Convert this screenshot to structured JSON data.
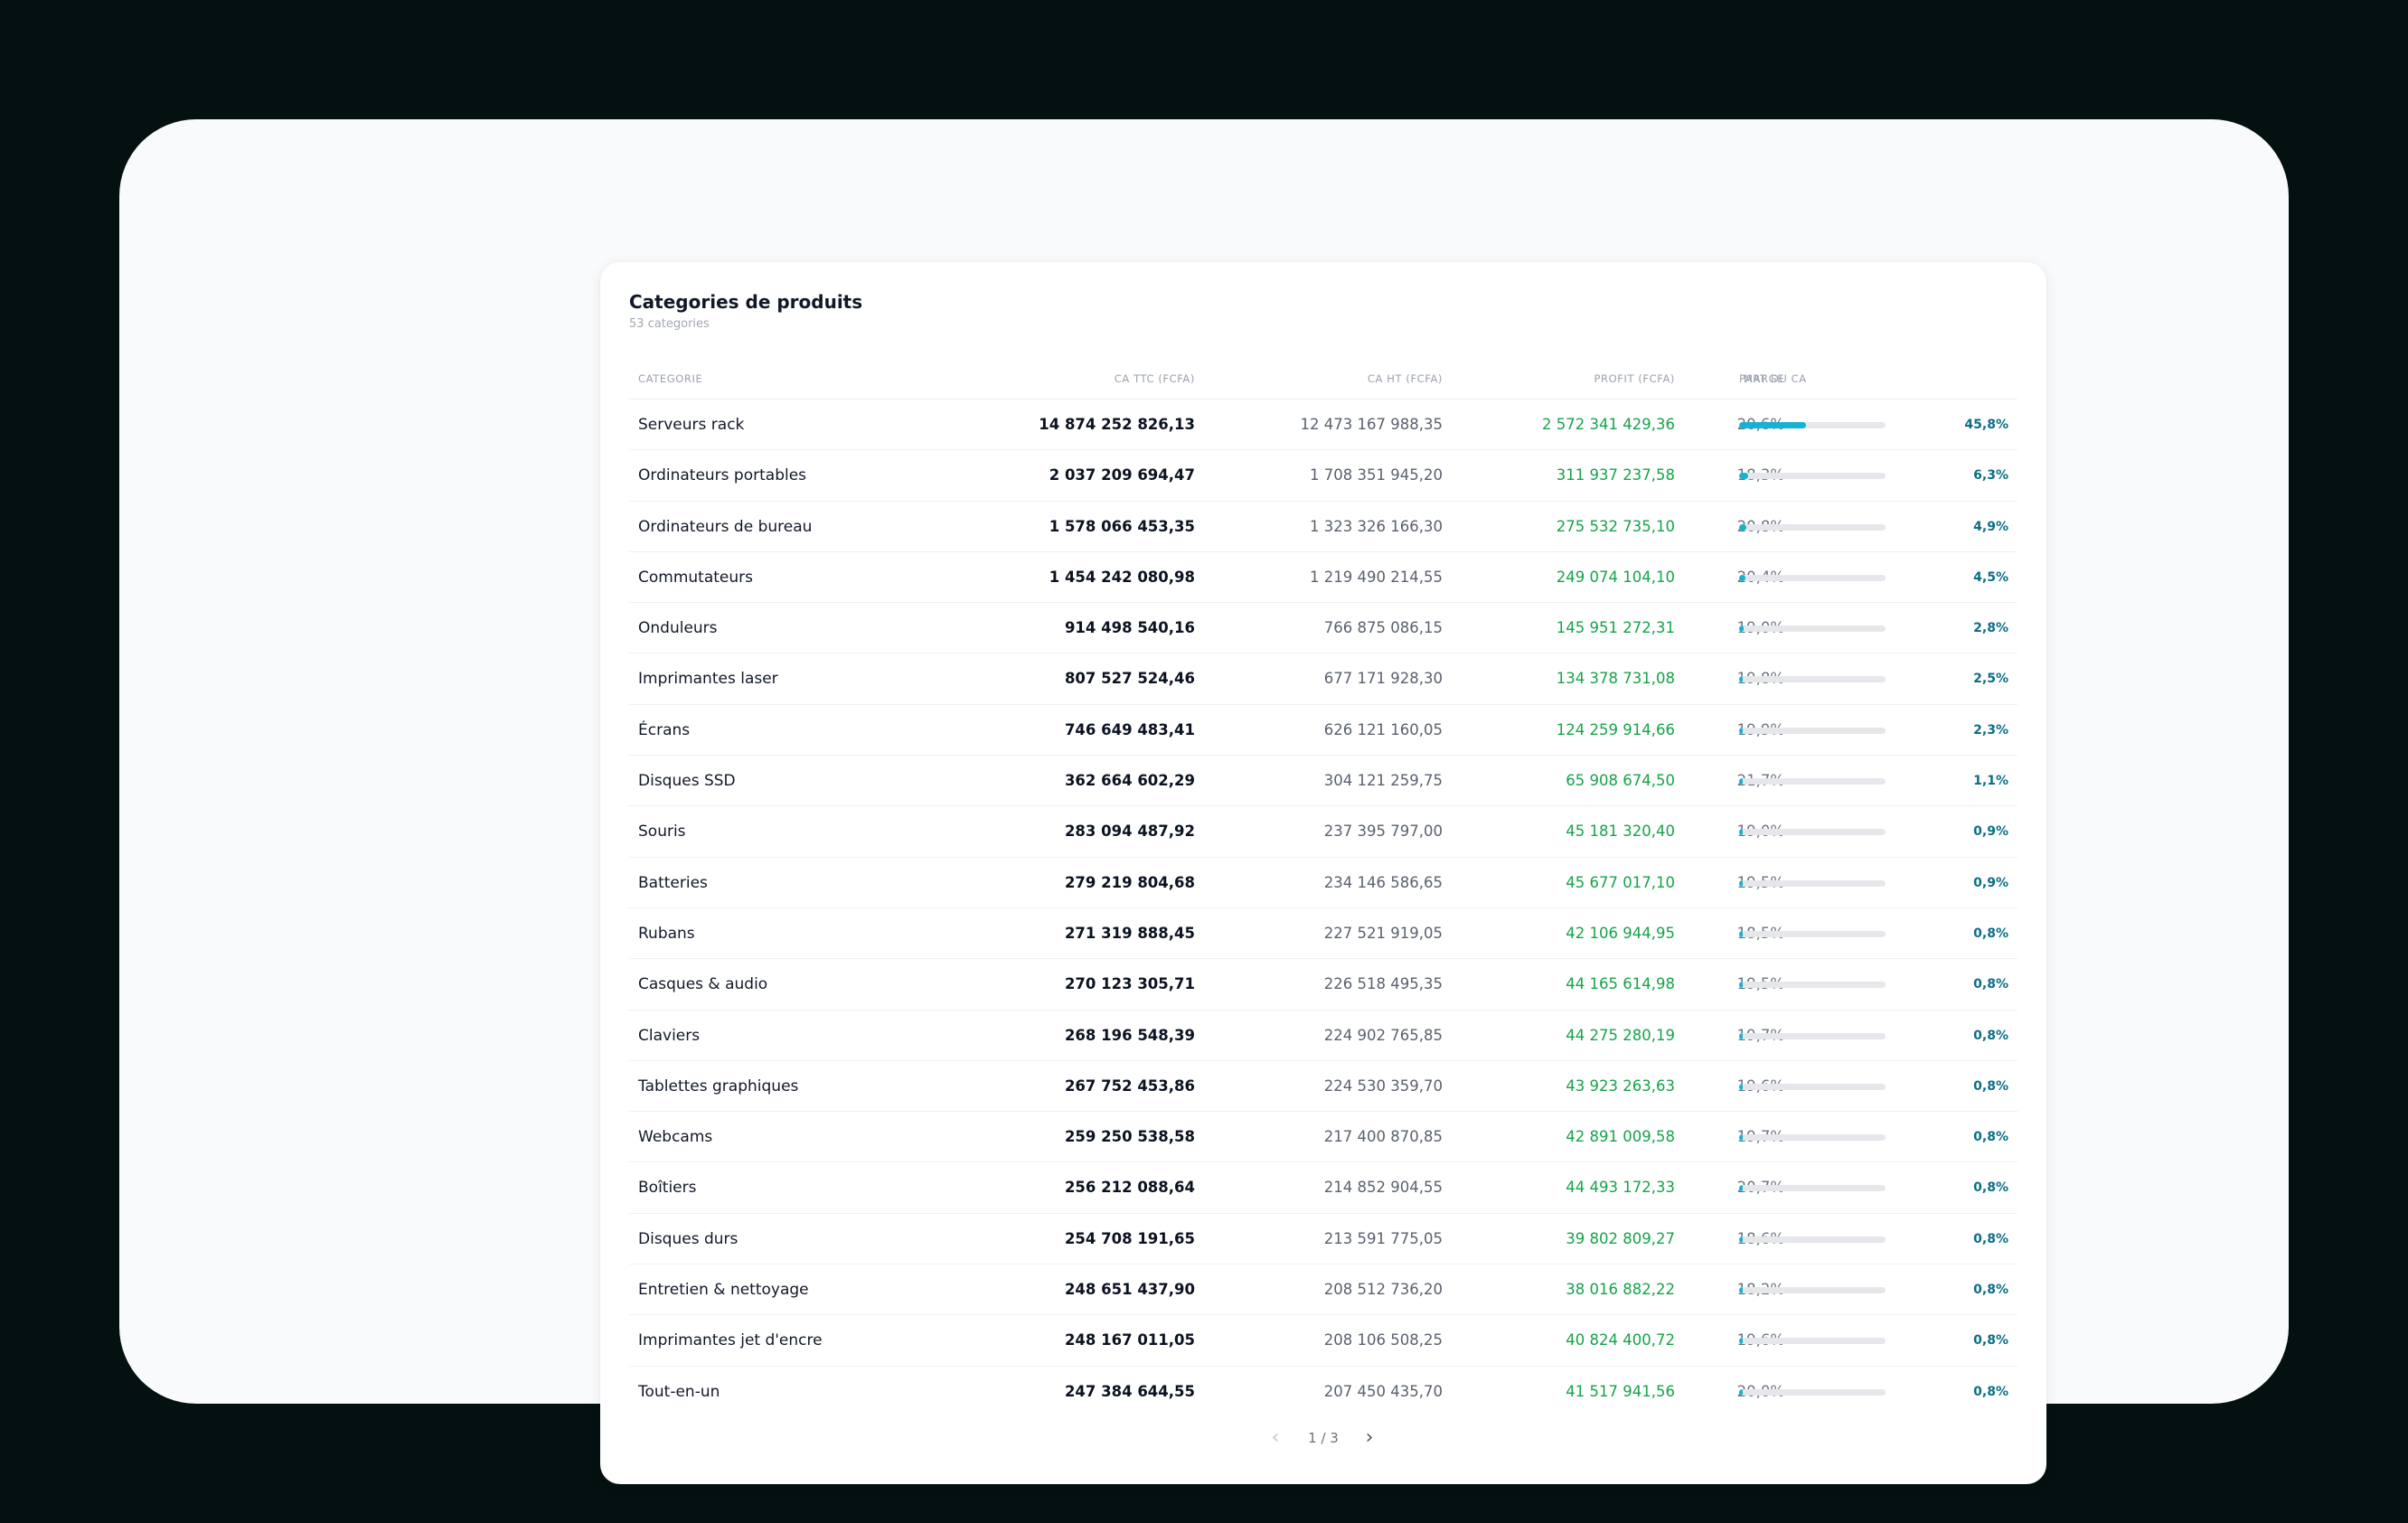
{
  "card": {
    "title": "Categories de produits",
    "subtitle": "53 categories"
  },
  "columns": {
    "categorie": "CATEGORIE",
    "ca_ttc": "CA TTC (FCFA)",
    "ca_ht": "CA HT (FCFA)",
    "profit": "PROFIT (FCFA)",
    "marge": "MARGE",
    "part": "PART DU CA"
  },
  "colors": {
    "bar_fill": "#16b2d4",
    "bar_track": "#e5e7eb",
    "profit_text": "#16a34a",
    "part_text": "#0b6e86"
  },
  "rows": [
    {
      "name": "Serveurs rack",
      "ca_ttc": "14 874 252 826,13",
      "ca_ht": "12 473 167 988,35",
      "profit": "2 572 341 429,36",
      "marge": "20,6%",
      "part": "45,8%",
      "part_value": 45.8
    },
    {
      "name": "Ordinateurs portables",
      "ca_ttc": "2 037 209 694,47",
      "ca_ht": "1 708 351 945,20",
      "profit": "311 937 237,58",
      "marge": "18,3%",
      "part": "6,3%",
      "part_value": 6.3
    },
    {
      "name": "Ordinateurs de bureau",
      "ca_ttc": "1 578 066 453,35",
      "ca_ht": "1 323 326 166,30",
      "profit": "275 532 735,10",
      "marge": "20,8%",
      "part": "4,9%",
      "part_value": 4.9
    },
    {
      "name": "Commutateurs",
      "ca_ttc": "1 454 242 080,98",
      "ca_ht": "1 219 490 214,55",
      "profit": "249 074 104,10",
      "marge": "20,4%",
      "part": "4,5%",
      "part_value": 4.5
    },
    {
      "name": "Onduleurs",
      "ca_ttc": "914 498 540,16",
      "ca_ht": "766 875 086,15",
      "profit": "145 951 272,31",
      "marge": "19,0%",
      "part": "2,8%",
      "part_value": 2.8
    },
    {
      "name": "Imprimantes laser",
      "ca_ttc": "807 527 524,46",
      "ca_ht": "677 171 928,30",
      "profit": "134 378 731,08",
      "marge": "19,8%",
      "part": "2,5%",
      "part_value": 2.5
    },
    {
      "name": "Écrans",
      "ca_ttc": "746 649 483,41",
      "ca_ht": "626 121 160,05",
      "profit": "124 259 914,66",
      "marge": "19,9%",
      "part": "2,3%",
      "part_value": 2.3
    },
    {
      "name": "Disques SSD",
      "ca_ttc": "362 664 602,29",
      "ca_ht": "304 121 259,75",
      "profit": "65 908 674,50",
      "marge": "21,7%",
      "part": "1,1%",
      "part_value": 1.1
    },
    {
      "name": "Souris",
      "ca_ttc": "283 094 487,92",
      "ca_ht": "237 395 797,00",
      "profit": "45 181 320,40",
      "marge": "19,0%",
      "part": "0,9%",
      "part_value": 0.9
    },
    {
      "name": "Batteries",
      "ca_ttc": "279 219 804,68",
      "ca_ht": "234 146 586,65",
      "profit": "45 677 017,10",
      "marge": "19,5%",
      "part": "0,9%",
      "part_value": 0.9
    },
    {
      "name": "Rubans",
      "ca_ttc": "271 319 888,45",
      "ca_ht": "227 521 919,05",
      "profit": "42 106 944,95",
      "marge": "18,5%",
      "part": "0,8%",
      "part_value": 0.8
    },
    {
      "name": "Casques & audio",
      "ca_ttc": "270 123 305,71",
      "ca_ht": "226 518 495,35",
      "profit": "44 165 614,98",
      "marge": "19,5%",
      "part": "0,8%",
      "part_value": 0.8
    },
    {
      "name": "Claviers",
      "ca_ttc": "268 196 548,39",
      "ca_ht": "224 902 765,85",
      "profit": "44 275 280,19",
      "marge": "19,7%",
      "part": "0,8%",
      "part_value": 0.8
    },
    {
      "name": "Tablettes graphiques",
      "ca_ttc": "267 752 453,86",
      "ca_ht": "224 530 359,70",
      "profit": "43 923 263,63",
      "marge": "19,6%",
      "part": "0,8%",
      "part_value": 0.8
    },
    {
      "name": "Webcams",
      "ca_ttc": "259 250 538,58",
      "ca_ht": "217 400 870,85",
      "profit": "42 891 009,58",
      "marge": "19,7%",
      "part": "0,8%",
      "part_value": 0.8
    },
    {
      "name": "Boîtiers",
      "ca_ttc": "256 212 088,64",
      "ca_ht": "214 852 904,55",
      "profit": "44 493 172,33",
      "marge": "20,7%",
      "part": "0,8%",
      "part_value": 0.8
    },
    {
      "name": "Disques durs",
      "ca_ttc": "254 708 191,65",
      "ca_ht": "213 591 775,05",
      "profit": "39 802 809,27",
      "marge": "18,6%",
      "part": "0,8%",
      "part_value": 0.8
    },
    {
      "name": "Entretien & nettoyage",
      "ca_ttc": "248 651 437,90",
      "ca_ht": "208 512 736,20",
      "profit": "38 016 882,22",
      "marge": "18,2%",
      "part": "0,8%",
      "part_value": 0.8
    },
    {
      "name": "Imprimantes jet d'encre",
      "ca_ttc": "248 167 011,05",
      "ca_ht": "208 106 508,25",
      "profit": "40 824 400,72",
      "marge": "19,6%",
      "part": "0,8%",
      "part_value": 0.8
    },
    {
      "name": "Tout-en-un",
      "ca_ttc": "247 384 644,55",
      "ca_ht": "207 450 435,70",
      "profit": "41 517 941,56",
      "marge": "20,0%",
      "part": "0,8%",
      "part_value": 0.8
    }
  ],
  "pagination": {
    "text": "1 / 3",
    "prev_icon": "chevron-left-icon",
    "next_icon": "chevron-right-icon"
  }
}
